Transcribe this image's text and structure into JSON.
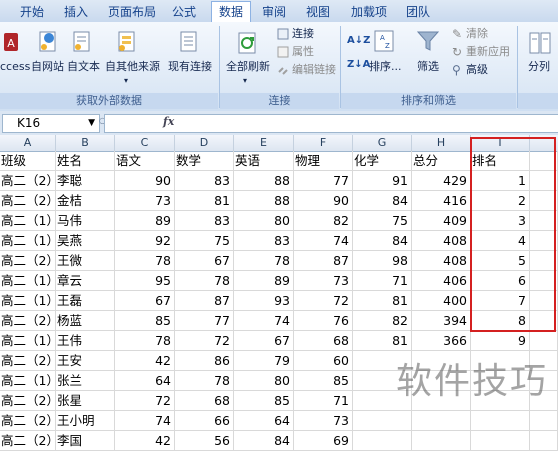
{
  "tabs": [
    "开始",
    "插入",
    "页面布局",
    "公式",
    "数据",
    "审阅",
    "视图",
    "加载项",
    "团队"
  ],
  "active_tab": "数据",
  "ribbon": {
    "groups": [
      {
        "label": "获取外部数据",
        "buttons": [
          "ccess",
          "自网站",
          "自文本",
          "自其他来源",
          "现有连接"
        ]
      },
      {
        "label": "连接",
        "buttons": [
          "全部刷新",
          "连接",
          "属性",
          "编辑链接"
        ]
      },
      {
        "label": "排序和筛选",
        "buttons": [
          "排序...",
          "筛选",
          "清除",
          "重新应用",
          "高级"
        ]
      },
      {
        "label": "",
        "buttons": [
          "分列"
        ]
      }
    ],
    "sort_az": "A↓Z",
    "sort_za": "Z↓A"
  },
  "formula_bar": {
    "name_box": "K16",
    "fx": "fx",
    "value": ""
  },
  "columns": [
    "A",
    "B",
    "C",
    "D",
    "E",
    "F",
    "G",
    "H",
    "I"
  ],
  "header_row": [
    "班级",
    "姓名",
    "语文",
    "数学",
    "英语",
    "物理",
    "化学",
    "总分",
    "排名"
  ],
  "rows": [
    [
      "高二（2）",
      "李聪",
      "90",
      "83",
      "88",
      "77",
      "91",
      "429",
      "1"
    ],
    [
      "高二（2）",
      "金桔",
      "73",
      "81",
      "88",
      "90",
      "84",
      "416",
      "2"
    ],
    [
      "高二（1）",
      "马伟",
      "89",
      "83",
      "80",
      "82",
      "75",
      "409",
      "3"
    ],
    [
      "高二（1）",
      "吴燕",
      "92",
      "75",
      "83",
      "74",
      "84",
      "408",
      "4"
    ],
    [
      "高二（2）",
      "王微",
      "78",
      "67",
      "78",
      "87",
      "98",
      "408",
      "5"
    ],
    [
      "高二（1）",
      "章云",
      "95",
      "78",
      "89",
      "73",
      "71",
      "406",
      "6"
    ],
    [
      "高二（1）",
      "王磊",
      "67",
      "87",
      "93",
      "72",
      "81",
      "400",
      "7"
    ],
    [
      "高二（2）",
      "杨蓝",
      "85",
      "77",
      "74",
      "76",
      "82",
      "394",
      "8"
    ],
    [
      "高二（1）",
      "王伟",
      "78",
      "72",
      "67",
      "68",
      "81",
      "366",
      "9"
    ],
    [
      "高二（2）",
      "王安",
      "42",
      "86",
      "79",
      "60",
      "",
      "",
      ""
    ],
    [
      "高二（1）",
      "张兰",
      "64",
      "78",
      "80",
      "85",
      "",
      "",
      ""
    ],
    [
      "高二（2）",
      "张星",
      "72",
      "68",
      "85",
      "71",
      "",
      "",
      ""
    ],
    [
      "高二（2）",
      "王小明",
      "74",
      "66",
      "64",
      "73",
      "",
      "",
      ""
    ],
    [
      "高二（2）",
      "李国",
      "42",
      "56",
      "84",
      "69",
      "",
      "",
      ""
    ]
  ],
  "watermark": "软件技巧"
}
